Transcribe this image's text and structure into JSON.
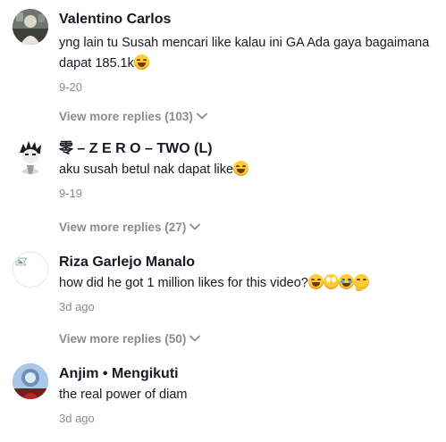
{
  "comments": [
    {
      "username": "Valentino Carlos",
      "text": "yng lain tu Susah mencari like kalau ini GA Ada gaya bagaimana dapat 185.1k",
      "emojis": [
        "face-with-tears-of-joy"
      ],
      "date": "9-20",
      "replies_label": "View more replies (103)"
    },
    {
      "username": "零 – Z E R O – TWO (L)",
      "text": "aku susah betul nak dapat like",
      "emojis": [
        "face-with-tears-of-joy"
      ],
      "date": "9-19",
      "replies_label": "View more replies (27)"
    },
    {
      "username": "Riza Garlejo Manalo",
      "text": "how did he got 1 million likes for this video?",
      "emojis": [
        "face-with-tears-of-joy",
        "face-with-rolling-eyes",
        "loudly-crying-face",
        "thinking-face"
      ],
      "date": "3d ago",
      "replies_label": "View more replies (50)"
    },
    {
      "username": "Anjim • Mengikuti",
      "text": "the real power of diam",
      "emojis": [],
      "date": "3d ago"
    }
  ],
  "colors": {
    "primary_text": "#161823",
    "secondary_text": "#8a8b91",
    "background": "#ffffff"
  },
  "icons": {
    "replies_expand": "chevron-down-icon",
    "broken_avatar": "broken-image-icon"
  }
}
